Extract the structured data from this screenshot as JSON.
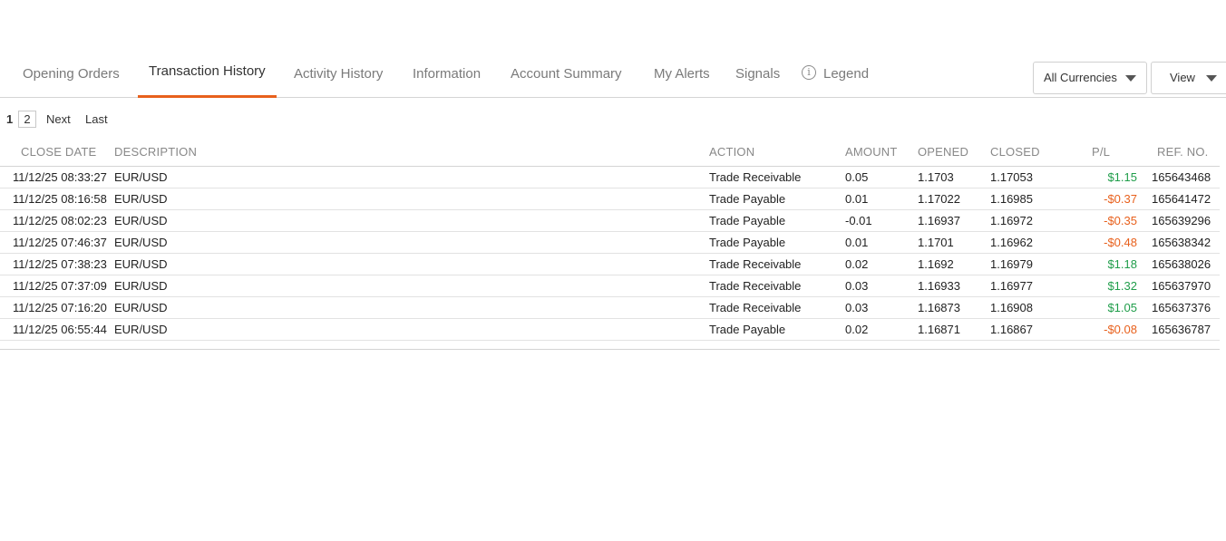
{
  "tabs": [
    {
      "label": "Opening Orders"
    },
    {
      "label": "Transaction History"
    },
    {
      "label": "Activity History"
    },
    {
      "label": "Information"
    },
    {
      "label": "Account Summary"
    },
    {
      "label": "My Alerts"
    },
    {
      "label": "Signals"
    },
    {
      "label": "Legend"
    }
  ],
  "active_tab": "Transaction History",
  "filters": {
    "currency": "All Currencies",
    "view": "View"
  },
  "pager": {
    "current": "1",
    "page2": "2",
    "next": "Next",
    "last": "Last"
  },
  "table": {
    "headers": [
      "CLOSE DATE",
      "DESCRIPTION",
      "ACTION",
      "AMOUNT",
      "OPENED",
      "CLOSED",
      "P/L",
      "REF. NO."
    ],
    "rows": [
      {
        "close_date": "11/12/25 08:33:27",
        "description": "EUR/USD",
        "action": "Trade Receivable",
        "amount": "0.05",
        "opened": "1.1703",
        "closed": "1.17053",
        "pl": "$1.15",
        "ref": "165643468"
      },
      {
        "close_date": "11/12/25 08:16:58",
        "description": "EUR/USD",
        "action": "Trade Payable",
        "amount": "0.01",
        "opened": "1.17022",
        "closed": "1.16985",
        "pl": "-$0.37",
        "ref": "165641472"
      },
      {
        "close_date": "11/12/25 08:02:23",
        "description": "EUR/USD",
        "action": "Trade Payable",
        "amount": "-0.01",
        "opened": "1.16937",
        "closed": "1.16972",
        "pl": "-$0.35",
        "ref": "165639296"
      },
      {
        "close_date": "11/12/25 07:46:37",
        "description": "EUR/USD",
        "action": "Trade Payable",
        "amount": "0.01",
        "opened": "1.1701",
        "closed": "1.16962",
        "pl": "-$0.48",
        "ref": "165638342"
      },
      {
        "close_date": "11/12/25 07:38:23",
        "description": "EUR/USD",
        "action": "Trade Receivable",
        "amount": "0.02",
        "opened": "1.1692",
        "closed": "1.16979",
        "pl": "$1.18",
        "ref": "165638026"
      },
      {
        "close_date": "11/12/25 07:37:09",
        "description": "EUR/USD",
        "action": "Trade Receivable",
        "amount": "0.03",
        "opened": "1.16933",
        "closed": "1.16977",
        "pl": "$1.32",
        "ref": "165637970"
      },
      {
        "close_date": "11/12/25 07:16:20",
        "description": "EUR/USD",
        "action": "Trade Receivable",
        "amount": "0.03",
        "opened": "1.16873",
        "closed": "1.16908",
        "pl": "$1.05",
        "ref": "165637376"
      },
      {
        "close_date": "11/12/25 06:55:44",
        "description": "EUR/USD",
        "action": "Trade Payable",
        "amount": "0.02",
        "opened": "1.16871",
        "closed": "1.16867",
        "pl": "-$0.08",
        "ref": "165636787"
      }
    ]
  },
  "colors": {
    "accent": "#e8601c",
    "positive": "#1f9d4a",
    "negative": "#e8601c"
  },
  "icons": {
    "legend": "info-circle-icon",
    "dropdown": "caret-down-icon"
  }
}
